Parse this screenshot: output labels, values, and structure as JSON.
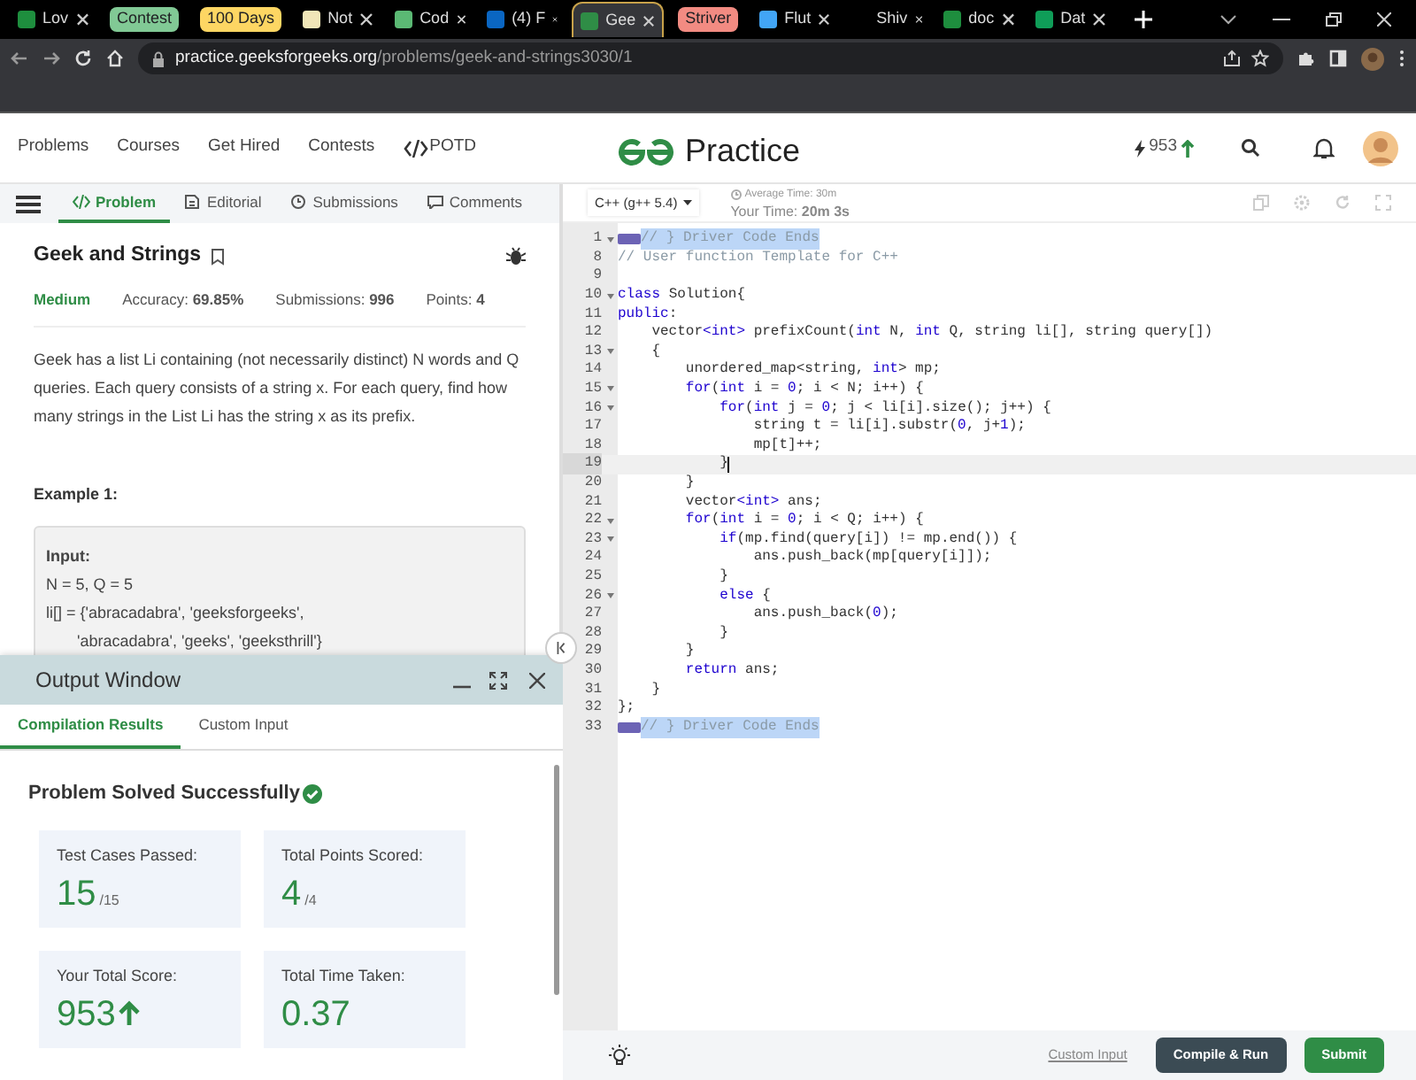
{
  "browser": {
    "tabs": [
      {
        "kind": "tab",
        "label": "Lov",
        "color": "#1e8e3e",
        "selected": false
      },
      {
        "kind": "group",
        "label": "Contest",
        "color": "#81c995",
        "selected": false
      },
      {
        "kind": "group",
        "label": "100 Days",
        "color": "#fdd663",
        "selected": false
      },
      {
        "kind": "tab",
        "label": "Not",
        "color": "#f1e6b8",
        "selected": false
      },
      {
        "kind": "tab",
        "label": "Cod",
        "color": "#5bb974",
        "selected": false
      },
      {
        "kind": "tab",
        "label": "(4) F",
        "color": "#0a66c2",
        "selected": false
      },
      {
        "kind": "tab",
        "label": "Gee",
        "color": "#2f8d46",
        "selected": true
      },
      {
        "kind": "group",
        "label": "Striver",
        "color": "#f28b82",
        "selected": false
      },
      {
        "kind": "tab",
        "label": "Flut",
        "color": "#42a5f5",
        "selected": false
      },
      {
        "kind": "tab",
        "label": "Shiv",
        "selected": false
      },
      {
        "kind": "tab",
        "label": "doc",
        "color": "#1e8e3e",
        "selected": false
      },
      {
        "kind": "tab",
        "label": "Dat",
        "color": "#0f9d58",
        "selected": false
      }
    ],
    "url_host": "practice.geeksforgeeks.org",
    "url_path": "/problems/geek-and-strings3030/1"
  },
  "site_nav": {
    "links": [
      "Problems",
      "Courses",
      "Get Hired",
      "Contests"
    ],
    "potd": "POTD",
    "logo_text": "Practice",
    "score": "953"
  },
  "problem_tabs": [
    {
      "label": "Problem",
      "selected": true
    },
    {
      "label": "Editorial",
      "selected": false
    },
    {
      "label": "Submissions",
      "selected": false
    },
    {
      "label": "Comments",
      "selected": false
    }
  ],
  "problem": {
    "title": "Geek and Strings",
    "difficulty": "Medium",
    "stats": [
      "Accuracy: **69.85%**",
      "Submissions: **996**",
      "Points: **4**"
    ],
    "description": "Geek has a list Li containing (not necessarily distinct) N words and Q queries. Each query consists of a string x. For each query, find how many strings in the List Li has the string x as its prefix.",
    "example_title": "Example 1:",
    "example_label": "Input:",
    "example_lines": [
      "N = 5, Q = 5",
      "li[] = {'abracadabra', 'geeksforgeeks',",
      "       'abracadabra', 'geeks', 'geeksthrill'}"
    ]
  },
  "output_window": {
    "title": "Output Window",
    "tabs": [
      {
        "label": "Compilation Results",
        "selected": true
      },
      {
        "label": "Custom Input",
        "selected": false
      }
    ],
    "status": "Problem Solved Successfully",
    "cards": [
      {
        "label": "Test Cases Passed:",
        "value": "15",
        "suffix": "/15"
      },
      {
        "label": "Total Points Scored:",
        "value": "4",
        "suffix": "/4"
      },
      {
        "label": "Your Total Score:",
        "value": "953",
        "rising": true
      },
      {
        "label": "Total Time Taken:",
        "value": "0.37"
      }
    ]
  },
  "editor": {
    "language": "C++ (g++ 5.4)",
    "average_time": "Average Time: 30m",
    "your_time": "Your Time: **20m 3s**",
    "lines": [
      {
        "n": "1",
        "fold": true,
        "folded": true,
        "selected": true,
        "current": false,
        "tokens": [
          {
            "kind": "comment",
            "text": "// } Driver Code Ends"
          }
        ]
      },
      {
        "n": "8",
        "fold": false,
        "folded": false,
        "selected": false,
        "current": false,
        "tokens": [
          {
            "kind": "comment",
            "text": "// User function Template for C++"
          }
        ]
      },
      {
        "n": "9",
        "fold": false,
        "folded": false,
        "selected": false,
        "current": false
      },
      {
        "n": "10",
        "fold": true,
        "folded": false,
        "selected": false,
        "current": false,
        "tokens": [
          {
            "kind": "keyword",
            "text": "class"
          },
          {
            "kind": "plain",
            "text": " Solution{"
          }
        ]
      },
      {
        "n": "11",
        "fold": false,
        "folded": false,
        "selected": false,
        "current": false,
        "tokens": [
          {
            "kind": "keyword",
            "text": "public"
          },
          {
            "kind": "plain",
            "text": ":"
          }
        ]
      },
      {
        "n": "12",
        "fold": false,
        "folded": false,
        "selected": false,
        "current": false,
        "tokens": [
          {
            "kind": "plain",
            "text": "    vector"
          },
          {
            "kind": "keyword",
            "text": "<int>"
          },
          {
            "kind": "plain",
            "text": " prefixCount("
          },
          {
            "kind": "keyword",
            "text": "int"
          },
          {
            "kind": "plain",
            "text": " N, "
          },
          {
            "kind": "keyword",
            "text": "int"
          },
          {
            "kind": "plain",
            "text": " Q, string li[], string query[])"
          }
        ]
      },
      {
        "n": "13",
        "fold": true,
        "folded": false,
        "selected": false,
        "current": false,
        "tokens": [
          {
            "kind": "plain",
            "text": "    {"
          }
        ]
      },
      {
        "n": "14",
        "fold": false,
        "folded": false,
        "selected": false,
        "current": false,
        "tokens": [
          {
            "kind": "plain",
            "text": "        unordered_map<string, "
          },
          {
            "kind": "keyword",
            "text": "int"
          },
          {
            "kind": "plain",
            "text": "> mp;"
          }
        ]
      },
      {
        "n": "15",
        "fold": true,
        "folded": false,
        "selected": false,
        "current": false,
        "tokens": [
          {
            "kind": "keyword",
            "text": "        for"
          },
          {
            "kind": "plain",
            "text": "("
          },
          {
            "kind": "keyword",
            "text": "int"
          },
          {
            "kind": "plain",
            "text": " i = "
          },
          {
            "kind": "number",
            "text": "0"
          },
          {
            "kind": "plain",
            "text": "; i < N; i++) {"
          }
        ]
      },
      {
        "n": "16",
        "fold": true,
        "folded": false,
        "selected": false,
        "current": false,
        "tokens": [
          {
            "kind": "keyword",
            "text": "            for"
          },
          {
            "kind": "plain",
            "text": "("
          },
          {
            "kind": "keyword",
            "text": "int"
          },
          {
            "kind": "plain",
            "text": " j = "
          },
          {
            "kind": "number",
            "text": "0"
          },
          {
            "kind": "plain",
            "text": "; j < li[i].size(); j++) {"
          }
        ]
      },
      {
        "n": "17",
        "fold": false,
        "folded": false,
        "selected": false,
        "current": false,
        "tokens": [
          {
            "kind": "plain",
            "text": "                string t = li[i].substr("
          },
          {
            "kind": "number",
            "text": "0"
          },
          {
            "kind": "plain",
            "text": ", j+"
          },
          {
            "kind": "number",
            "text": "1"
          },
          {
            "kind": "plain",
            "text": ");"
          }
        ]
      },
      {
        "n": "18",
        "fold": false,
        "folded": false,
        "selected": false,
        "current": false,
        "tokens": [
          {
            "kind": "plain",
            "text": "                mp[t]++;"
          }
        ]
      },
      {
        "n": "19",
        "fold": false,
        "folded": false,
        "selected": false,
        "current": true,
        "tokens": [
          {
            "kind": "plain",
            "text": "            }"
          }
        ]
      },
      {
        "n": "20",
        "fold": false,
        "folded": false,
        "selected": false,
        "current": false,
        "tokens": [
          {
            "kind": "plain",
            "text": "        }"
          }
        ]
      },
      {
        "n": "21",
        "fold": false,
        "folded": false,
        "selected": false,
        "current": false,
        "tokens": [
          {
            "kind": "plain",
            "text": "        vector"
          },
          {
            "kind": "keyword",
            "text": "<int>"
          },
          {
            "kind": "plain",
            "text": " ans;"
          }
        ]
      },
      {
        "n": "22",
        "fold": true,
        "folded": false,
        "selected": false,
        "current": false,
        "tokens": [
          {
            "kind": "keyword",
            "text": "        for"
          },
          {
            "kind": "plain",
            "text": "("
          },
          {
            "kind": "keyword",
            "text": "int"
          },
          {
            "kind": "plain",
            "text": " i = "
          },
          {
            "kind": "number",
            "text": "0"
          },
          {
            "kind": "plain",
            "text": "; i < Q; i++) {"
          }
        ]
      },
      {
        "n": "23",
        "fold": true,
        "folded": false,
        "selected": false,
        "current": false,
        "tokens": [
          {
            "kind": "keyword",
            "text": "            if"
          },
          {
            "kind": "plain",
            "text": "(mp.find(query[i]) != mp.end()) {"
          }
        ]
      },
      {
        "n": "24",
        "fold": false,
        "folded": false,
        "selected": false,
        "current": false,
        "tokens": [
          {
            "kind": "plain",
            "text": "                ans.push_back(mp[query[i]]);"
          }
        ]
      },
      {
        "n": "25",
        "fold": false,
        "folded": false,
        "selected": false,
        "current": false,
        "tokens": [
          {
            "kind": "plain",
            "text": "            }"
          }
        ]
      },
      {
        "n": "26",
        "fold": true,
        "folded": false,
        "selected": false,
        "current": false,
        "tokens": [
          {
            "kind": "keyword",
            "text": "            else"
          },
          {
            "kind": "plain",
            "text": " {"
          }
        ]
      },
      {
        "n": "27",
        "fold": false,
        "folded": false,
        "selected": false,
        "current": false,
        "tokens": [
          {
            "kind": "plain",
            "text": "                ans.push_back("
          },
          {
            "kind": "number",
            "text": "0"
          },
          {
            "kind": "plain",
            "text": ");"
          }
        ]
      },
      {
        "n": "28",
        "fold": false,
        "folded": false,
        "selected": false,
        "current": false,
        "tokens": [
          {
            "kind": "plain",
            "text": "            }"
          }
        ]
      },
      {
        "n": "29",
        "fold": false,
        "folded": false,
        "selected": false,
        "current": false,
        "tokens": [
          {
            "kind": "plain",
            "text": "        }"
          }
        ]
      },
      {
        "n": "30",
        "fold": false,
        "folded": false,
        "selected": false,
        "current": false,
        "tokens": [
          {
            "kind": "keyword",
            "text": "        return"
          },
          {
            "kind": "plain",
            "text": " ans;"
          }
        ]
      },
      {
        "n": "31",
        "fold": false,
        "folded": false,
        "selected": false,
        "current": false,
        "tokens": [
          {
            "kind": "plain",
            "text": "    }"
          }
        ]
      },
      {
        "n": "32",
        "fold": false,
        "folded": false,
        "selected": false,
        "current": false,
        "tokens": [
          {
            "kind": "plain",
            "text": "};"
          }
        ]
      },
      {
        "n": "33",
        "fold": false,
        "folded": true,
        "selected": true,
        "current": false,
        "tokens": [
          {
            "kind": "comment",
            "text": "// } Driver Code Ends"
          }
        ]
      }
    ],
    "custom_input": "Custom Input",
    "compile_button": "Compile & Run",
    "submit_button": "Submit"
  }
}
